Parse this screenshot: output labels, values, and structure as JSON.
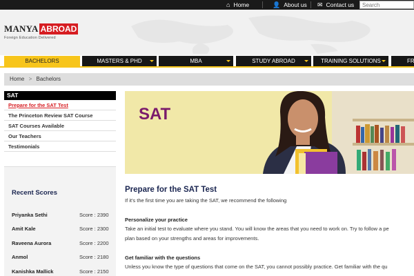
{
  "topbar": {
    "links": [
      {
        "label": "Home",
        "icon": "home-icon"
      },
      {
        "label": "About us",
        "icon": "user-icon"
      },
      {
        "label": "Contact us",
        "icon": "envelope-icon"
      }
    ],
    "search_placeholder": "Search"
  },
  "header": {
    "logo_part1": "MANYA",
    "logo_part2": "ABROAD",
    "tagline": "Foreign Education Delivered",
    "brand_color": "#d61d22"
  },
  "nav": {
    "items": [
      "BACHELORS",
      "MASTERS & PHD",
      "MBA",
      "STUDY ABROAD",
      "TRAINING SOLUTIONS",
      "FR"
    ],
    "active": "BACHELORS",
    "accent_color": "#f7c51b"
  },
  "breadcrumb": {
    "items": [
      "Home",
      "Bachelors"
    ],
    "separator": ">"
  },
  "sidebar": {
    "heading": "SAT",
    "items": [
      {
        "label": "Prepare for the SAT Test",
        "current": true
      },
      {
        "label": "The Princeton Review SAT Course",
        "current": false
      },
      {
        "label": "SAT Courses Available",
        "current": false
      },
      {
        "label": "Our Teachers",
        "current": false
      },
      {
        "label": "Testimonials",
        "current": false
      }
    ]
  },
  "recent_scores": {
    "title": "Recent Scores",
    "rows": [
      {
        "name": "Priyanka Sethi",
        "score": "Score : 2390"
      },
      {
        "name": "Amit Kale",
        "score": "Score : 2300"
      },
      {
        "name": "Raveena Aurora",
        "score": "Score : 2200"
      },
      {
        "name": "Anmol",
        "score": "Score : 2180"
      },
      {
        "name": "Kanishka Mallick",
        "score": "Score : 2150"
      }
    ]
  },
  "banner": {
    "title": "SAT"
  },
  "main": {
    "title": "Prepare for the SAT Test",
    "intro": "If it's the first time you are taking the SAT, we recommend the following",
    "sections": [
      {
        "heading": "Personalize your practice",
        "lines": [
          "Take an initial test to evaluate where you stand. You will know the areas that you need to work on. Try to follow a pe",
          "plan based on your strengths and areas for improvements."
        ]
      },
      {
        "heading": "Get familiar with the questions",
        "lines": [
          "Unless you know the type of questions that come on the SAT, you cannot possibly practice. Get familiar with the qu"
        ]
      }
    ]
  }
}
